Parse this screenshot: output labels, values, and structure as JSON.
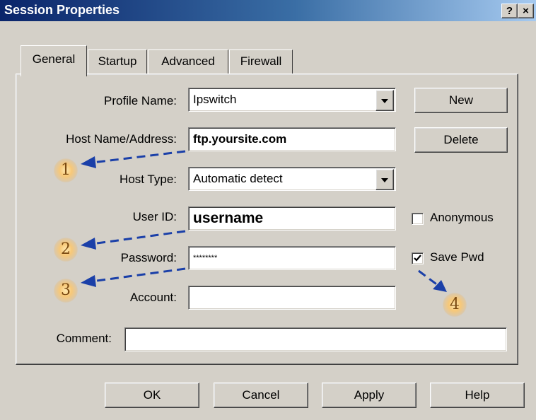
{
  "window": {
    "title": "Session Properties",
    "help_glyph": "?",
    "close_glyph": "×"
  },
  "tabs": [
    "General",
    "Startup",
    "Advanced",
    "Firewall"
  ],
  "form": {
    "profile_label": "Profile Name:",
    "profile_value": "Ipswitch",
    "host_label": "Host Name/Address:",
    "host_value": "ftp.yoursite.com",
    "hosttype_label": "Host Type:",
    "hosttype_value": "Automatic detect",
    "userid_label": "User ID:",
    "userid_value": "username",
    "password_label": "Password:",
    "password_value": "********",
    "account_label": "Account:",
    "account_value": "",
    "comment_label": "Comment:",
    "comment_value": ""
  },
  "side_buttons": {
    "new": "New",
    "delete": "Delete"
  },
  "checkboxes": {
    "anonymous": "Anonymous",
    "anonymous_checked": false,
    "save_pwd": "Save Pwd",
    "save_pwd_checked": true
  },
  "bottom_buttons": {
    "ok": "OK",
    "cancel": "Cancel",
    "apply": "Apply",
    "help": "Help"
  },
  "markers": [
    "1",
    "2",
    "3",
    "4"
  ],
  "colors": {
    "title_start": "#0a246a",
    "title_end": "#a6caf0",
    "arrow": "#1a3fa8",
    "face": "#d4d0c8"
  }
}
